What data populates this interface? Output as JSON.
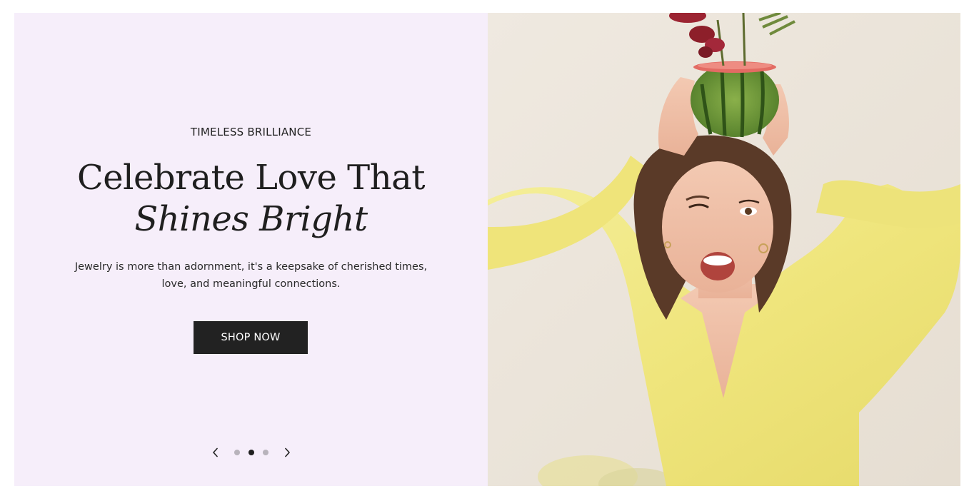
{
  "hero": {
    "eyebrow": "TIMELESS BRILLIANCE",
    "headline_line1": "Celebrate Love That",
    "headline_line2": "Shines Bright",
    "description": "Jewelry is more than adornment, it's a keepsake of cherished times, love, and meaningful connections.",
    "cta_label": "SHOP NOW",
    "image_alt": "Smiling woman winking with a small watermelon planter on her head",
    "slider": {
      "prev_icon": "chevron-left-icon",
      "next_icon": "chevron-right-icon",
      "slide_count": 3,
      "active_slide": 2
    }
  },
  "colors": {
    "panel_background": "#f6eefa",
    "button_background": "#222222",
    "button_text": "#ffffff",
    "dot_inactive": "#b8b3bb",
    "dot_active": "#1f1f1f",
    "blouse_yellow": "#f1ea8c"
  }
}
